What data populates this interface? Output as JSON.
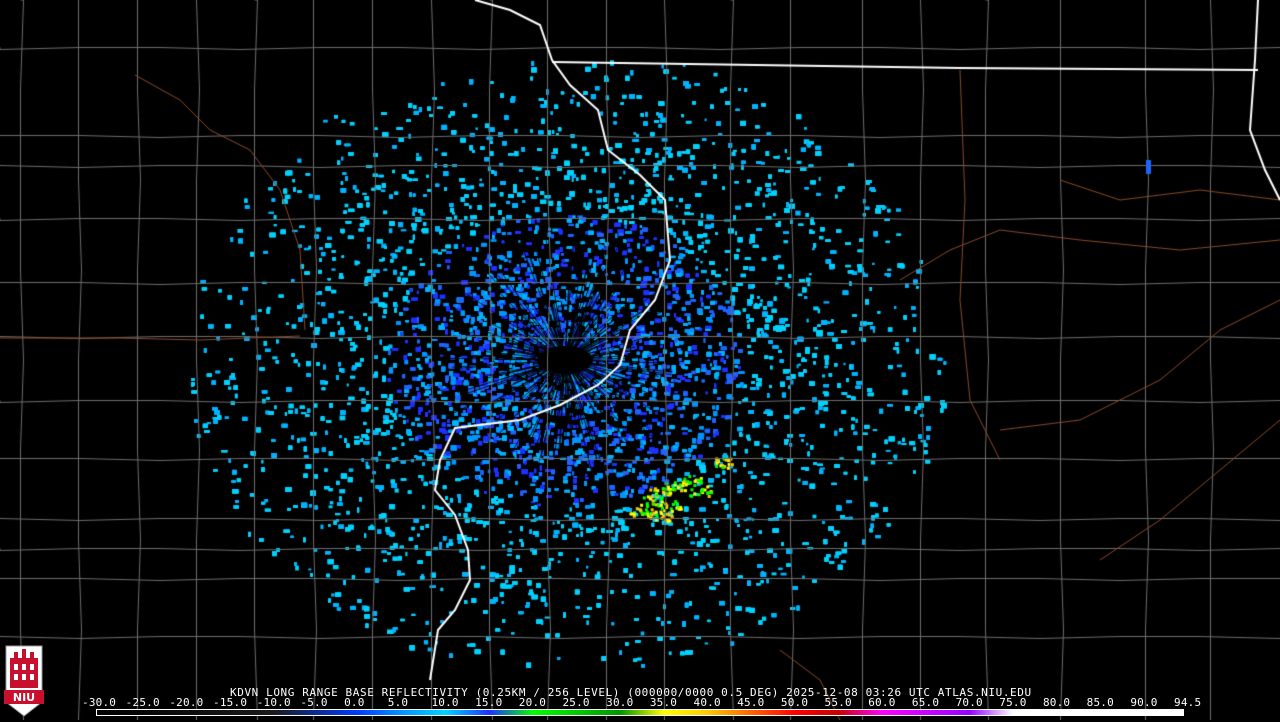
{
  "product_line": "KDVN LONG RANGE BASE REFLECTIVITY (0.25KM / 256 LEVEL) (000000/0000 0.5 DEG) 2025-12-08 03:26 UTC  ATLAS.NIU.EDU",
  "scale_labels": [
    "-30.0",
    "-25.0",
    "-20.0",
    "-15.0",
    "-10.0",
    "-5.0",
    "0.0",
    "5.0",
    "10.0",
    "15.0",
    "20.0",
    "25.0",
    "30.0",
    "35.0",
    "40.0",
    "45.0",
    "50.0",
    "55.0",
    "60.0",
    "65.0",
    "70.0",
    "75.0",
    "80.0",
    "85.0",
    "90.0",
    "94.5"
  ],
  "scale_colors": [
    {
      "dbz": -30,
      "color": "#000000"
    },
    {
      "dbz": -10,
      "color": "#1a1a1a"
    },
    {
      "dbz": 0,
      "color": "#003cff"
    },
    {
      "dbz": 5,
      "color": "#0096ff"
    },
    {
      "dbz": 10,
      "color": "#00d2ff"
    },
    {
      "dbz": 15,
      "color": "#1e32ff"
    },
    {
      "dbz": 20,
      "color": "#00ff00"
    },
    {
      "dbz": 30,
      "color": "#009600"
    },
    {
      "dbz": 35,
      "color": "#ffff00"
    },
    {
      "dbz": 40,
      "color": "#ffc800"
    },
    {
      "dbz": 45,
      "color": "#ff6400"
    },
    {
      "dbz": 50,
      "color": "#ff0000"
    },
    {
      "dbz": 55,
      "color": "#c80000"
    },
    {
      "dbz": 60,
      "color": "#ff00ff"
    },
    {
      "dbz": 70,
      "color": "#9600ff"
    },
    {
      "dbz": 75,
      "color": "#ffffff"
    },
    {
      "dbz": 94.5,
      "color": "#ffffff"
    }
  ],
  "logo": {
    "text": "NIU",
    "color": "#c8102e"
  },
  "colors": {
    "background": "#000000",
    "county_lines": "#6e6e6e",
    "state_lines": "#ffffff",
    "rivers_roads": "#8b4a2a"
  }
}
